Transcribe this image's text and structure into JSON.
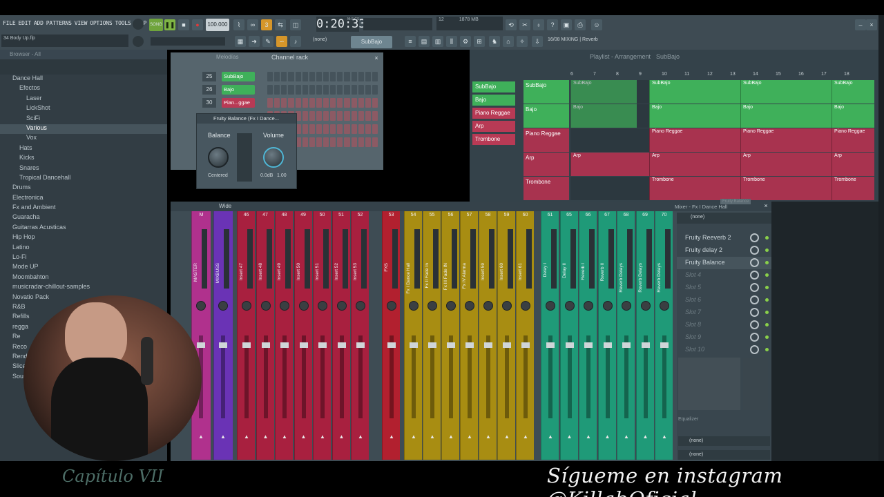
{
  "menu": [
    "FILE",
    "EDIT",
    "ADD",
    "PATTERNS",
    "VIEW",
    "OPTIONS",
    "TOOLS",
    "HELP"
  ],
  "hint": "34 Body Up.flp",
  "transport": {
    "song_label": "SONG",
    "tempo": "100.000",
    "time": "0:20:33",
    "time_sub": "M:S:CS",
    "cpu": "12",
    "mem": "1878 MB",
    "mem2": "1",
    "pattern": "SubBajo",
    "none_label": "(none)",
    "mixing": "16/08 MIXING | Reverb"
  },
  "browser": {
    "title": "Browser - All",
    "items": [
      "Dance Hall",
      "Efectos",
      "Laser",
      "LickShot",
      "SciFi",
      "Various",
      "Vox",
      "Hats",
      "Kicks",
      "Snares",
      "Tropical Dancehall",
      "Drums",
      "Electronica",
      "Fx and Ambient",
      "Guaracha",
      "Guitarras Acusticas",
      "Hip Hop",
      "Latino",
      "Lo-Fi",
      "Mode UP",
      "Moombahton",
      "musicradar-chillout-samples",
      "Novatio Pack",
      "R&B",
      "Refills",
      "regga",
      "Re",
      "Reco",
      "Rendere",
      "Sliced audio",
      "Soundfonts"
    ]
  },
  "channel_rack": {
    "tab_left": "Melodías",
    "title": "Channel rack",
    "channels": [
      {
        "num": "25",
        "name": "SubBajo",
        "color": "#3fb05a"
      },
      {
        "num": "26",
        "name": "Bajo",
        "color": "#3fb05a"
      },
      {
        "num": "30",
        "name": "Pian...ggae",
        "color": "#b83a55"
      }
    ]
  },
  "balance_window": {
    "title": "Fruity Balance (Fx I Dance...",
    "balance_label": "Balance",
    "volume_label": "Volume",
    "centered": "Centered",
    "db": "0.0dB",
    "vol": "1.00",
    "scale": [
      "0",
      "6",
      "12",
      "18",
      "24",
      "30",
      "39"
    ]
  },
  "playlist": {
    "title": "Playlist - Arrangement",
    "crumb": "SubBajo",
    "ruler": [
      "6",
      "7",
      "8",
      "9",
      "10",
      "11",
      "12",
      "13",
      "14",
      "15",
      "16",
      "17",
      "18"
    ],
    "picker": [
      {
        "name": "SubBajo",
        "color": "#3fb05a"
      },
      {
        "name": "Bajo",
        "color": "#3fb05a"
      },
      {
        "name": "Piano Reggae",
        "color": "#b83a55"
      },
      {
        "name": "Arp",
        "color": "#b83a55"
      },
      {
        "name": "Trombone",
        "color": "#b83a55"
      }
    ],
    "tracks": [
      {
        "name": "SubBajo",
        "color": "#3fb05a",
        "clip": "SubBajo"
      },
      {
        "name": "Bajo",
        "color": "#3fb05a",
        "clip": "Bajo"
      },
      {
        "name": "Piano Reggae",
        "color": "#a8334f",
        "clip": "Piano Reggae"
      },
      {
        "name": "Arp",
        "color": "#a8334f",
        "clip": "Arp"
      },
      {
        "name": "Trombone",
        "color": "#a8334f",
        "clip": "Trombone"
      }
    ]
  },
  "mixer": {
    "title": "Mixer - Fx I Dance Hall",
    "view": "Wide",
    "tooltip": "Fruity Balance",
    "preset": "(none)",
    "strips": [
      {
        "num": "M",
        "name": "MASTER",
        "color": "#b0318d"
      },
      {
        "num": "",
        "name": "MIXBUSS",
        "color": "#6a33b5"
      },
      {
        "num": "46",
        "name": "Insert 47",
        "color": "#a8203f"
      },
      {
        "num": "47",
        "name": "Insert 48",
        "color": "#a8203f"
      },
      {
        "num": "48",
        "name": "Insert 49",
        "color": "#a8203f"
      },
      {
        "num": "49",
        "name": "Insert 50",
        "color": "#a8203f"
      },
      {
        "num": "50",
        "name": "Insert 51",
        "color": "#a8203f"
      },
      {
        "num": "51",
        "name": "Insert 52",
        "color": "#a8203f"
      },
      {
        "num": "52",
        "name": "Insert 53",
        "color": "#a8203f"
      },
      {
        "num": "53",
        "name": "FXS",
        "color": "#b2202f"
      },
      {
        "num": "54",
        "name": "Fx I Dance Hall",
        "color": "#a88d12"
      },
      {
        "num": "55",
        "name": "Fx II Fade In",
        "color": "#a88d12"
      },
      {
        "num": "56",
        "name": "Fx III Fade IN",
        "color": "#a88d12"
      },
      {
        "num": "57",
        "name": "Fx IV Alarma",
        "color": "#a88d12"
      },
      {
        "num": "58",
        "name": "Insert 59",
        "color": "#a88d12"
      },
      {
        "num": "59",
        "name": "Insert 60",
        "color": "#a88d12"
      },
      {
        "num": "60",
        "name": "Insert 61",
        "color": "#a88d12"
      },
      {
        "num": "61",
        "name": "Delay I",
        "color": "#1f9a78"
      },
      {
        "num": "65",
        "name": "Delay II",
        "color": "#1f9a78"
      },
      {
        "num": "66",
        "name": "Reverb I",
        "color": "#1f9a78"
      },
      {
        "num": "67",
        "name": "Reverb II",
        "color": "#1f9a78"
      },
      {
        "num": "68",
        "name": "Reverb Delays",
        "color": "#1f9a78"
      },
      {
        "num": "69",
        "name": "Reverb Delays",
        "color": "#1f9a78"
      },
      {
        "num": "70",
        "name": "Reverb Delays",
        "color": "#1f9a78"
      }
    ],
    "slots": [
      "Fruity Reeverb 2",
      "Fruity delay 2",
      "Fruity Balance",
      "Slot 4",
      "Slot 5",
      "Slot 6",
      "Slot 7",
      "Slot 8",
      "Slot 9",
      "Slot 10"
    ],
    "equalizer": "Equalizer",
    "out_in": "(none)",
    "out_out": "(none)"
  },
  "overlay": {
    "chapter": "Capítulo VII",
    "instagram": "Sígueme en instagram @KillabOficial"
  }
}
